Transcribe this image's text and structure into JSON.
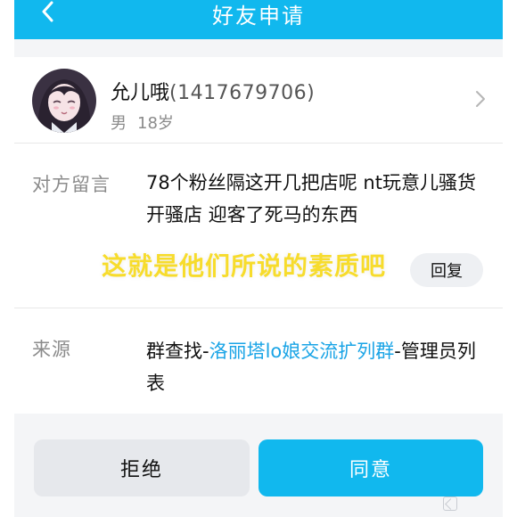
{
  "header": {
    "title": "好友申请",
    "bg_color": "#11b8ee"
  },
  "profile": {
    "nickname": "允儿哦",
    "qq_number": "(1417679706)",
    "gender": "男",
    "age": "18岁"
  },
  "message": {
    "label": "对方留言",
    "text": "78个粉丝隔这开几把店呢 nt玩意儿骚货开骚店 迎客了死马的东西",
    "overlay_caption": "这就是他们所说的素质吧",
    "reply_label": "回复"
  },
  "source": {
    "label": "来源",
    "prefix": "群查找-",
    "group_link": "洛丽塔lo娘交流扩列群",
    "suffix": "-管理员列表",
    "link_color": "#1aa4e6"
  },
  "actions": {
    "reject_label": "拒绝",
    "accept_label": "同意",
    "accept_color": "#11b8ee"
  },
  "icons": {
    "back": "chevron-left-icon",
    "detail": "chevron-right-icon"
  }
}
